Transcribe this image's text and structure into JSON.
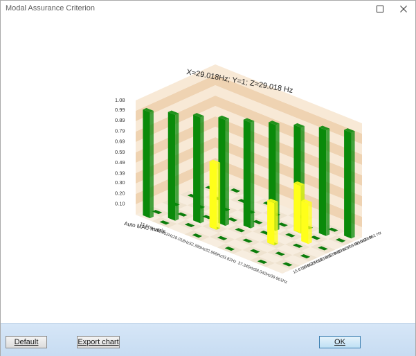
{
  "window": {
    "title": "Modal Assurance Criterion",
    "maximize_icon": "maximize-icon",
    "close_icon": "close-icon"
  },
  "buttons": {
    "default": "Default",
    "export": "Export chart",
    "ok": "OK"
  },
  "colors": {
    "diag_bar": "#0a8a0a",
    "offdiag_bar": "#ffff1a",
    "floor_light": "#f6e9d8",
    "wall_dark": "#efd3b2"
  },
  "chart_data": {
    "type": "bar3d",
    "title": "",
    "tooltip": "X=29.018Hz; Y=1; Z=29.018 Hz",
    "xlabel": "Auto MAC matrix",
    "x_ticks": [
      "15.619Hz",
      "16.852Hz",
      "29.018Hz",
      "32.385Hz",
      "32.998Hz",
      "33.82Hz",
      "37.345Hz",
      "38.042Hz",
      "39.961Hz"
    ],
    "z_ticks": [
      "15.619 Hz",
      "16.852 Hz",
      "29.018 Hz",
      "32.385 Hz",
      "32.998 Hz",
      "33.82 Hz",
      "37.345 Hz",
      "38.042 Hz",
      "39.961 Hz"
    ],
    "y_ticks": [
      "0.10",
      "0.20",
      "0.30",
      "0.39",
      "0.49",
      "0.59",
      "0.69",
      "0.79",
      "0.89",
      "0.99",
      "1.08"
    ],
    "ylim": [
      0,
      1.08
    ],
    "diagonal_values": [
      1,
      1,
      1,
      1,
      1,
      1,
      1,
      1,
      1
    ],
    "highlight_values": [
      {
        "x": "32.385Hz",
        "z": "29.018 Hz",
        "value": 0.62
      },
      {
        "x": "37.345Hz",
        "z": "32.385 Hz",
        "value": 0.4
      },
      {
        "x": "38.042Hz",
        "z": "33.82 Hz",
        "value": 0.38
      },
      {
        "x": "37.345Hz",
        "z": "37.345 Hz",
        "value": 0.45
      }
    ]
  }
}
